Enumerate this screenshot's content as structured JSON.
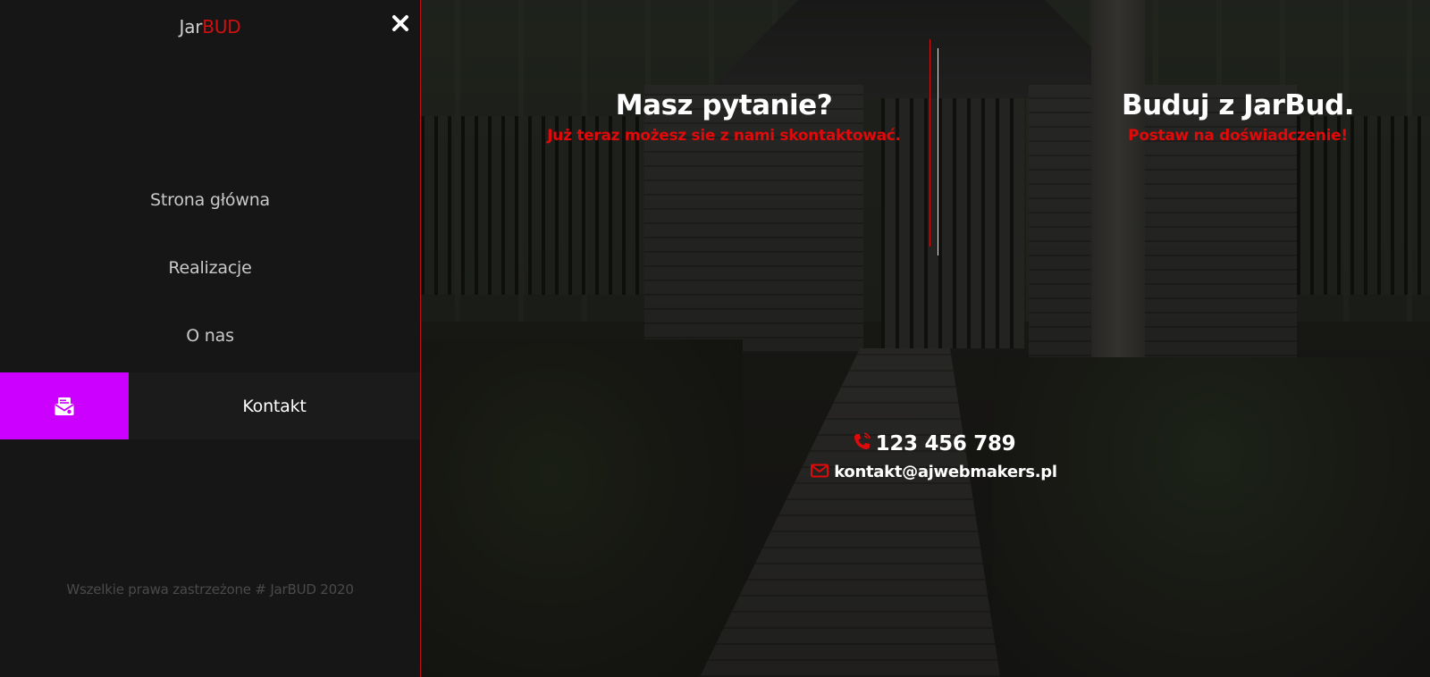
{
  "logo": {
    "part1": "Jar",
    "part2": "BUD"
  },
  "menu": {
    "items": [
      {
        "label": "Strona główna",
        "active": false
      },
      {
        "label": "Realizacje",
        "active": false
      },
      {
        "label": "O nas",
        "active": false
      },
      {
        "label": "Kontakt",
        "active": true,
        "icon": "contact-card-icon"
      }
    ]
  },
  "footer": {
    "text": "Wszelkie prawa zastrzeżone # JarBUD 2020"
  },
  "hero": {
    "left_title": "Masz pytanie?",
    "left_subtitle": "Już teraz możesz sie z nami skontaktować.",
    "right_title": "Buduj z JarBud.",
    "right_subtitle": "Postaw na doświadczenie!"
  },
  "contact": {
    "phone": "123 456 789",
    "email": "kontakt@ajwebmakers.pl",
    "phone_icon": "phone-icon",
    "email_icon": "envelope-icon"
  },
  "colors": {
    "accent_red": "#e10a0a",
    "active_purple": "#cc00ff",
    "sidebar_bg": "#161616"
  },
  "icons": {
    "close": "close-icon"
  }
}
